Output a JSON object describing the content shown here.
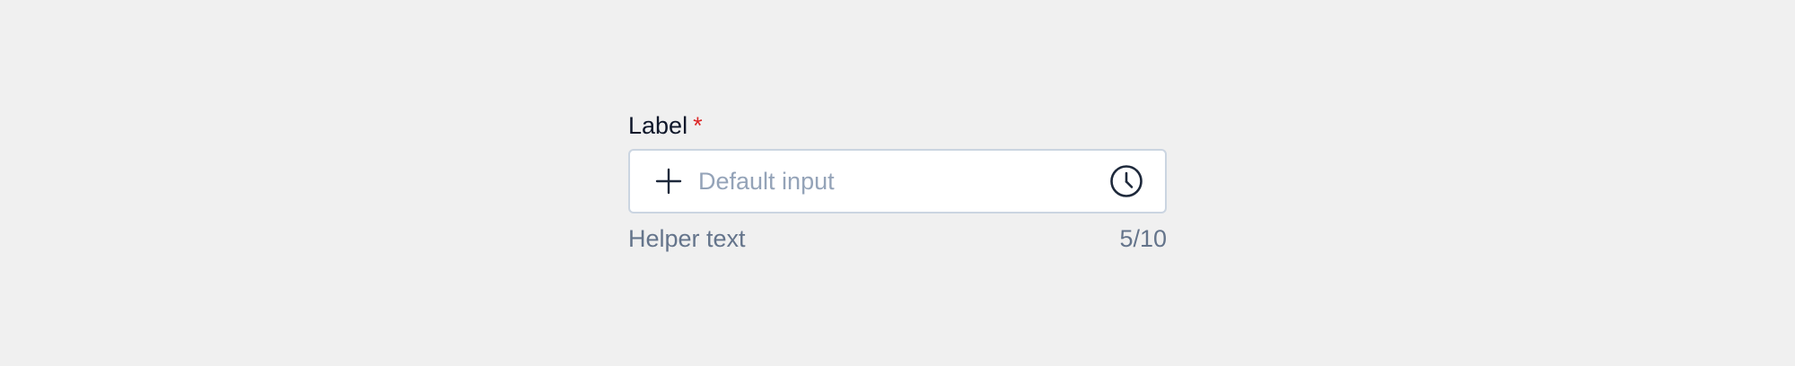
{
  "field": {
    "label": "Label",
    "required_mark": "*",
    "placeholder": "Default input",
    "value": "",
    "helper_text": "Helper text",
    "counter": "5/10",
    "leading_icon": "plus-icon",
    "trailing_icon": "clock-icon"
  },
  "colors": {
    "background": "#f0f0f0",
    "label": "#0f172a",
    "required": "#dc2626",
    "placeholder": "#94a3b8",
    "helper": "#64748b",
    "border": "#cbd5e1",
    "icon": "#1e293b"
  }
}
